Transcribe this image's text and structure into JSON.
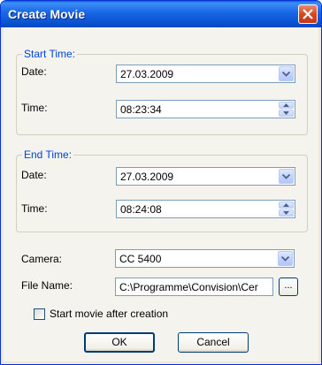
{
  "window": {
    "title": "Create Movie"
  },
  "start_time": {
    "group_label": "Start Time:",
    "date_label": "Date:",
    "date_value": "27.03.2009",
    "time_label": "Time:",
    "time_value": "08:23:34"
  },
  "end_time": {
    "group_label": "End Time:",
    "date_label": "Date:",
    "date_value": "27.03.2009",
    "time_label": "Time:",
    "time_value": "08:24:08"
  },
  "camera": {
    "label": "Camera:",
    "value": "CC 5400"
  },
  "file_name": {
    "label": "File Name:",
    "value": "C:\\Programme\\Convision\\Cer",
    "browse_label": "..."
  },
  "start_movie_checkbox": {
    "label": "Start movie after creation",
    "checked": false
  },
  "buttons": {
    "ok": "OK",
    "cancel": "Cancel"
  },
  "colors": {
    "titlebar": "#0a52d6",
    "group_label": "#0046d5",
    "close_button": "#d64a20",
    "dialog_bg": "#f4f3ee"
  }
}
